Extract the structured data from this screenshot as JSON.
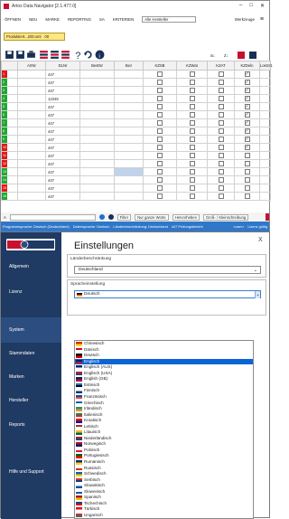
{
  "app": {
    "title": "Artos Data Navigator [2.1.477.0]",
    "menu": [
      "ÖFFNEN",
      "NEU",
      "MARKE",
      "REPORTING",
      "SA",
      "KRITERIEN"
    ],
    "menu_select": "Alle Hersteller",
    "menu_right": [
      "Werkzeuge"
    ],
    "file_tab": "Produktiert...200.xml",
    "file_tab_extra": "00"
  },
  "grid": {
    "columns": [
      "",
      "ArtNr",
      "DLNr",
      "BestNr",
      "Bez",
      "KZSB",
      "KZWat",
      "KZAT",
      "KZDeln",
      "LosGr1"
    ],
    "rows": [
      {
        "flag": "r",
        "label": "1",
        "dlnr": "447",
        "kzdeln": true
      },
      {
        "flag": "g",
        "label": "2",
        "dlnr": "447",
        "kzdeln": true
      },
      {
        "flag": "g",
        "label": "3",
        "dlnr": "447",
        "kzdeln": true
      },
      {
        "flag": "g",
        "label": "4",
        "dlnr": "12345",
        "kzdeln": true
      },
      {
        "flag": "g",
        "label": "5",
        "dlnr": "447",
        "kzdeln": true
      },
      {
        "flag": "g",
        "label": "6",
        "dlnr": "447",
        "kzdeln": true
      },
      {
        "flag": "g",
        "label": "7",
        "dlnr": "447",
        "kzdeln": true
      },
      {
        "flag": "g",
        "label": "8",
        "dlnr": "447",
        "kzdeln": true
      },
      {
        "flag": "g",
        "label": "9",
        "dlnr": "447",
        "kzdeln": true
      },
      {
        "flag": "r",
        "label": "10",
        "dlnr": "447",
        "kzdeln": true
      },
      {
        "flag": "r",
        "label": "11",
        "dlnr": "447",
        "kzdeln": false
      },
      {
        "flag": "r",
        "label": "12",
        "dlnr": "447",
        "kzdeln": false
      },
      {
        "flag": "g",
        "label": "13",
        "dlnr": "447",
        "kzdeln": false,
        "blue": true
      },
      {
        "flag": "g",
        "label": "14",
        "dlnr": "447",
        "kzdeln": false
      },
      {
        "flag": "r",
        "label": "15",
        "dlnr": "447",
        "kzdeln": false
      },
      {
        "flag": "g",
        "label": "16",
        "dlnr": "447",
        "kzdeln": false
      }
    ]
  },
  "filterbar": {
    "left": "A",
    "buttons": [
      "Filter",
      "Nur ganze Worte",
      "Hervorheben",
      "Groß- / Kleinschreibung"
    ]
  },
  "statusbar": {
    "items": [
      "Programmsprache: Deutsch (Deutschland)",
      "Datensprache: Deutsch",
      "Länderbeschränkung: Deutschland",
      "447 Prüfungsbericht"
    ],
    "user": "<user>",
    "license": "Lizenz gültig"
  },
  "dialog": {
    "title": "Einstellungen",
    "close": "X",
    "logo": "ARTOS SOLUTION",
    "sidebar": [
      "Allgemein",
      "Lizenz",
      "System",
      "Stammdaten",
      "Marken",
      "Hersteller",
      "Reports",
      "Hilfe und Support"
    ],
    "active_index": 2,
    "country_label": "Länderbeschränkung",
    "country_value": "Deutschland",
    "lang_label": "Spracheinstellung",
    "lang_value": "Deutsch",
    "languages": [
      "Chinesisch",
      "Dänisch",
      "Deutsch",
      "Englisch",
      "Englisch (AUS)",
      "Englisch (USA)",
      "English (GB)",
      "Estnisch",
      "Finnisch",
      "Französisch",
      "Griechisch",
      "Irländisch",
      "Italienisch",
      "Kroatisch",
      "Lettisch",
      "Litauisch",
      "Niederländisch",
      "Norwegisch",
      "Polnisch",
      "Portugiesisch",
      "Rumänisch",
      "Russisch",
      "Schwedisch",
      "Serbisch",
      "Slowakisch",
      "Slowenisch",
      "Spanisch",
      "Tschechisch",
      "Türkisch",
      "Ungarisch"
    ],
    "highlight_index": 3
  }
}
